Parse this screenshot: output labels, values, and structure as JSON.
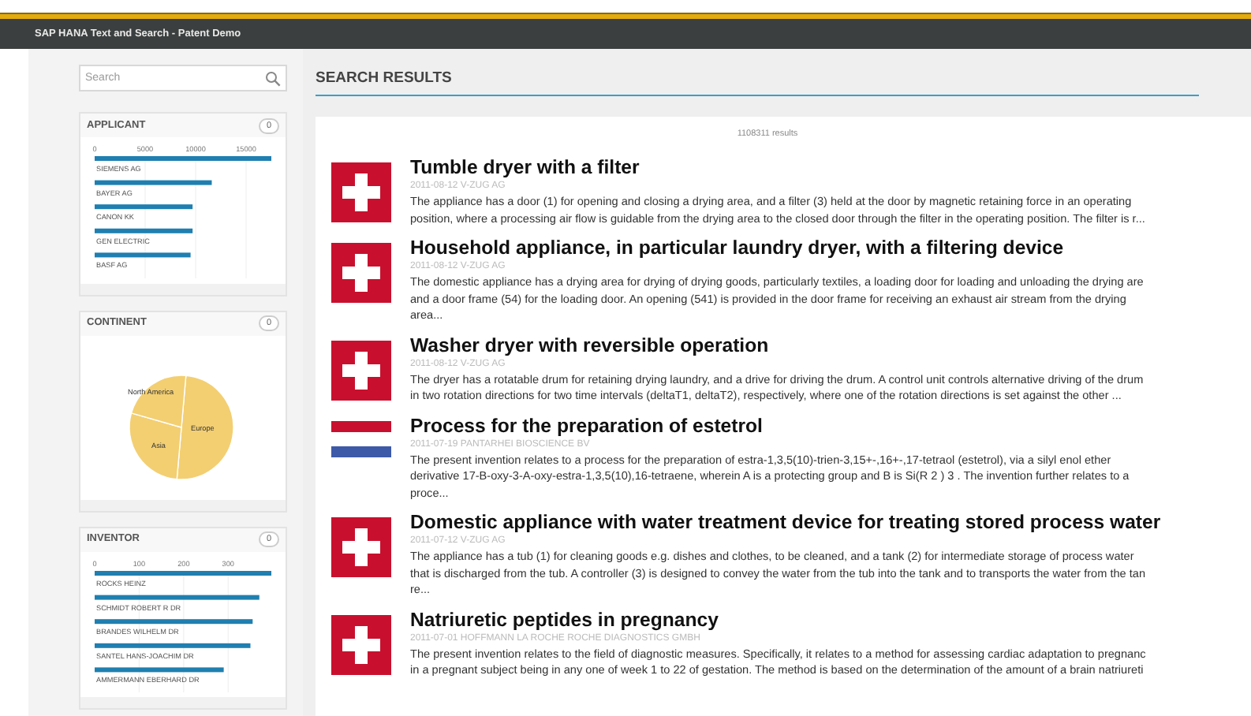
{
  "window": {
    "title": "SAP HANA Text and Search - Patent Demo"
  },
  "sidebar": {
    "search": {
      "placeholder": "Search"
    },
    "facets": [
      {
        "kind": "bar",
        "title": "APPLICANT",
        "count": "0",
        "chart_data": {
          "type": "bar",
          "orientation": "horizontal",
          "categories": [
            "SIEMENS AG",
            "BAYER AG",
            "CANON KK",
            "GEN ELECTRIC",
            "BASF AG"
          ],
          "values": [
            17500,
            11600,
            9700,
            9700,
            9500
          ],
          "xlim": [
            0,
            17500
          ],
          "xticks": [
            0,
            5000,
            10000,
            15000
          ],
          "grid": true
        }
      },
      {
        "kind": "pie",
        "title": "CONTINENT",
        "count": "0",
        "labels": [
          "North America",
          "Europe",
          "Asia"
        ]
      },
      {
        "kind": "bar",
        "title": "INVENTOR",
        "count": "0",
        "chart_data": {
          "type": "bar",
          "orientation": "horizontal",
          "categories": [
            "ROCKS HEINZ",
            "SCHMIDT ROBERT R DR",
            "BRANDES WILHELM DR",
            "SANTEL HANS-JOACHIM DR",
            "AMMERMANN EBERHARD DR"
          ],
          "values": [
            397,
            370,
            355,
            350,
            290
          ],
          "xlim": [
            0,
            397
          ],
          "xticks": [
            0,
            100,
            200,
            300
          ],
          "grid": true
        }
      }
    ]
  },
  "main": {
    "heading": "SEARCH RESULTS",
    "result_count": "1108311 results",
    "results": [
      {
        "kind": "swiss",
        "title": "Tumble dryer with a filter",
        "meta": "2011-08-12 V-ZUG AG",
        "lines": [
          "The appliance has a door (1) for opening and closing a drying area, and a filter (3) held at the door by magnetic retaining force in an operating",
          "position, where a processing air flow is guidable from the drying area to the closed door through the filter in the operating position. The filter is r..."
        ]
      },
      {
        "kind": "swiss",
        "title": "Household appliance, in particular laundry dryer, with a filtering device",
        "meta": "2011-08-12 V-ZUG AG",
        "lines": [
          "The domestic appliance has a drying area for drying of drying goods, particularly textiles, a loading door for loading and unloading the drying are",
          "and a door frame (54) for the loading door. An opening (541) is provided in the door frame for receiving an exhaust air stream from the drying",
          "area..."
        ]
      },
      {
        "kind": "swiss",
        "title": "Washer dryer with reversible operation",
        "meta": "2011-08-12 V-ZUG AG",
        "lines": [
          "The dryer has a rotatable drum for retaining drying laundry, and a drive for driving the drum. A control unit controls alternative driving of the drum",
          "in two rotation directions for two time intervals (deltaT1, deltaT2), respectively, where one of the rotation directions is set against the other ..."
        ]
      },
      {
        "kind": "netherlands",
        "title": "Process for the preparation of estetrol",
        "meta": "2011-07-19 PANTARHEI BIOSCIENCE BV",
        "lines": [
          "The present invention relates to a process for the preparation of estra-1,3,5(10)-trien-3,15+-,16+-,17-tetraol (estetrol), via a silyl enol ether",
          "derivative 17-B-oxy-3-A-oxy-estra-1,3,5(10),16-tetraene, wherein A is a protecting group and B is Si(R 2 ) 3 . The invention further relates to a",
          "proce..."
        ]
      },
      {
        "kind": "swiss",
        "title": "Domestic appliance with water treatment device for treating stored process water",
        "meta": "2011-07-12 V-ZUG AG",
        "lines": [
          "The appliance has a tub (1) for cleaning goods e.g. dishes and clothes, to be cleaned, and a tank (2) for intermediate storage of process water",
          "that is discharged from the tub. A controller (3) is designed to convey the water from the tub into the tank and to transports the water from the tan",
          "re..."
        ]
      },
      {
        "kind": "swiss",
        "title": "Natriuretic peptides in pregnancy",
        "meta": "2011-07-01 HOFFMANN LA ROCHE ROCHE DIAGNOSTICS GMBH",
        "lines": [
          "The present invention relates to the field of diagnostic measures. Specifically, it relates to a method for assessing cardiac adaptation to pregnanc",
          "in a pregnant subject being in any one of week 1 to 22 of gestation. The method is based on the determination of the amount of a brain natriureti"
        ]
      }
    ]
  }
}
